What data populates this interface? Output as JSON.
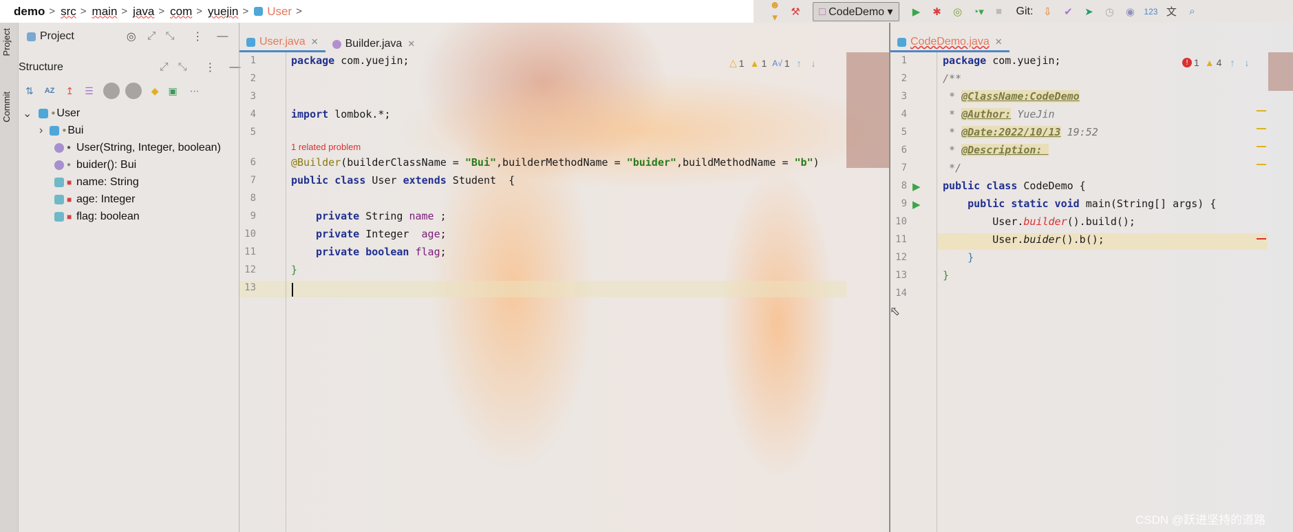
{
  "breadcrumb": {
    "project": "demo",
    "path": [
      "src",
      "main",
      "java",
      "com",
      "yuejin"
    ],
    "current": "User"
  },
  "toolbar": {
    "run_config": "CodeDemo",
    "git_label": "Git:",
    "icons": [
      "user-icon",
      "hammer-icon",
      "run-icon",
      "debug-icon",
      "coverage-icon",
      "profile-icon",
      "stop-icon",
      "update-icon",
      "commit-icon",
      "push-icon",
      "history-icon",
      "rollback-icon",
      "numbers-icon",
      "translate-icon",
      "search-icon"
    ]
  },
  "side_tabs": {
    "project": "Project",
    "commit": "Commit"
  },
  "project_panel": {
    "title": "Project"
  },
  "structure_panel": {
    "title": "Structure",
    "tree": [
      {
        "label": "User",
        "kind": "class"
      },
      {
        "label": "Bui",
        "kind": "class"
      },
      {
        "label": "User(String, Integer, boolean)",
        "kind": "constructor"
      },
      {
        "label": "buider(): Bui",
        "kind": "method"
      },
      {
        "label": "name: String",
        "kind": "field"
      },
      {
        "label": "age: Integer",
        "kind": "field"
      },
      {
        "label": "flag: boolean",
        "kind": "field"
      }
    ]
  },
  "left_editor": {
    "tabs": [
      {
        "label": "User.java",
        "active": true
      },
      {
        "label": "Builder.java",
        "active": false
      }
    ],
    "inspections": {
      "weak_warnings": "1",
      "warnings": "1",
      "typos": "1"
    },
    "related_problem": "1 related problem",
    "line_numbers": [
      "1",
      "2",
      "3",
      "4",
      "5",
      "6",
      "7",
      "8",
      "9",
      "10",
      "11",
      "12",
      "13"
    ],
    "lines": {
      "l1_kw": "package",
      "l1_rest": " com.yuejin;",
      "l4_kw": "import",
      "l4_rest": " lombok.*;",
      "l6_ann": "@Builder",
      "l6_a": "(builderClassName = ",
      "l6_s1": "\"Bui\"",
      "l6_b": ",builderMethodName = ",
      "l6_s2": "\"buider\"",
      "l6_c": ",buildMethodName = ",
      "l6_s3": "\"b\"",
      "l6_d": ")",
      "l7_kw1": "public class",
      "l7_a": " User ",
      "l7_kw2": "extends",
      "l7_b": " Student  {",
      "l9_kw": "private",
      "l9_a": " String ",
      "l9_f": "name",
      "l9_b": " ;",
      "l10_kw": "private",
      "l10_a": " Integer  ",
      "l10_f": "age",
      "l10_b": ";",
      "l11_kw": "private boolean",
      "l11_f": " flag",
      "l11_b": ";",
      "l12": "}"
    }
  },
  "right_editor": {
    "tabs": [
      {
        "label": "CodeDemo.java",
        "active": true
      }
    ],
    "inspections": {
      "errors": "1",
      "warnings": "4"
    },
    "line_numbers": [
      "1",
      "2",
      "3",
      "4",
      "5",
      "6",
      "7",
      "8",
      "9",
      "10",
      "11",
      "12",
      "13",
      "14"
    ],
    "lines": {
      "l1_kw": "package",
      "l1_rest": " com.yuejin;",
      "l2": "/**",
      "l3_star": " * ",
      "l3_tag": "@ClassName:CodeDemo",
      "l4_star": " * ",
      "l4_tag": "@Author:",
      "l4_rest": " YueJin",
      "l5_star": " * ",
      "l5_tag": "@Date:2022/10/13",
      "l5_rest": " 19:52",
      "l6_star": " * ",
      "l6_tag": "@Description: ",
      "l7": " */",
      "l8_kw": "public class",
      "l8_rest": " CodeDemo {",
      "l9_kw": "    public static void",
      "l9_rest": " main(String[] args) {",
      "l10_a": "        User.",
      "l10_m": "builder",
      "l10_b": "().build();",
      "l11_a": "        User.",
      "l11_m": "buider",
      "l11_b": "().b();",
      "l12": "    }",
      "l13": "}"
    }
  },
  "watermark": "CSDN @跃进坚持的道路",
  "colors": {
    "accent": "#4a88c7",
    "error": "#d83030",
    "warning": "#e0b020",
    "run": "#3aa64a"
  }
}
